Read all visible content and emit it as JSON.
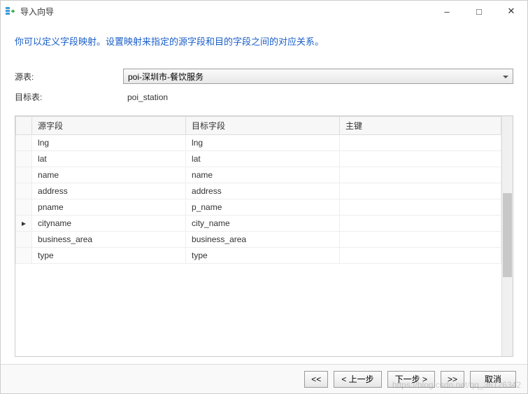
{
  "window": {
    "title": "导入向导"
  },
  "instruction": "你可以定义字段映射。设置映射来指定的源字段和目的字段之间的对应关系。",
  "form": {
    "source_label": "源表:",
    "source_value": "poi-深圳市-餐饮服务",
    "target_label": "目标表:",
    "target_value": "poi_station"
  },
  "table": {
    "headers": {
      "source": "源字段",
      "target": "目标字段",
      "pk": "主键"
    },
    "rows": [
      {
        "source": "lng",
        "target": "lng",
        "pk": "",
        "active": false
      },
      {
        "source": "lat",
        "target": "lat",
        "pk": "",
        "active": false
      },
      {
        "source": "name",
        "target": "name",
        "pk": "",
        "active": false
      },
      {
        "source": "address",
        "target": "address",
        "pk": "",
        "active": false
      },
      {
        "source": "pname",
        "target": "p_name",
        "pk": "",
        "active": false
      },
      {
        "source": "cityname",
        "target": "city_name",
        "pk": "",
        "active": true
      },
      {
        "source": "business_area",
        "target": "business_area",
        "pk": "",
        "active": false
      },
      {
        "source": "type",
        "target": "type",
        "pk": "",
        "active": false
      }
    ]
  },
  "footer": {
    "first": "<<",
    "prev": "< 上一步",
    "next": "下一步 >",
    "last": ">>",
    "cancel": "取消"
  },
  "watermark": "https://blog.csdn.net/qq_36126342"
}
